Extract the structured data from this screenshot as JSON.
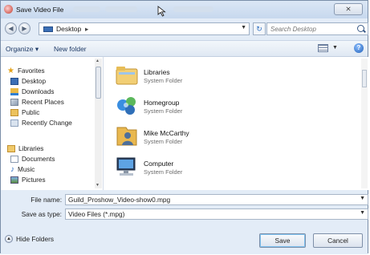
{
  "titlebar": {
    "title": "Save Video File",
    "close_label": "⨯"
  },
  "address": {
    "location": "Desktop",
    "separator": "▸",
    "search_placeholder": "Search Desktop"
  },
  "toolbar": {
    "organize_label": "Organize ▾",
    "new_folder_label": "New folder"
  },
  "nav": {
    "items": [
      {
        "label": "Favorites",
        "icon": "star-icon"
      },
      {
        "label": "Desktop",
        "icon": "desktop-icon"
      },
      {
        "label": "Downloads",
        "icon": "downloads-icon"
      },
      {
        "label": "Recent Places",
        "icon": "recent-places-icon"
      },
      {
        "label": "Public",
        "icon": "folder-icon"
      },
      {
        "label": "Recently Change",
        "icon": "recent-changed-icon"
      },
      {
        "label": "Libraries",
        "icon": "libraries-icon"
      },
      {
        "label": "Documents",
        "icon": "documents-icon"
      },
      {
        "label": "Music",
        "icon": "music-icon"
      },
      {
        "label": "Pictures",
        "icon": "pictures-icon"
      }
    ]
  },
  "files": [
    {
      "name": "Libraries",
      "type": "System Folder",
      "icon": "libraries-folder-icon"
    },
    {
      "name": "Homegroup",
      "type": "System Folder",
      "icon": "homegroup-icon"
    },
    {
      "name": "Mike McCarthy",
      "type": "System Folder",
      "icon": "user-folder-icon"
    },
    {
      "name": "Computer",
      "type": "System Folder",
      "icon": "computer-icon"
    }
  ],
  "form": {
    "filename_label": "File name:",
    "filename_value": "Guild_Proshow_Video-show0.mpg",
    "savetype_label": "Save as type:",
    "savetype_value": "Video Files (*.mpg)"
  },
  "footer": {
    "hide_folders_label": "Hide Folders",
    "save_label": "Save",
    "cancel_label": "Cancel"
  },
  "colors": {
    "chrome": "#e3ecf7",
    "accent": "#1e3a66"
  }
}
